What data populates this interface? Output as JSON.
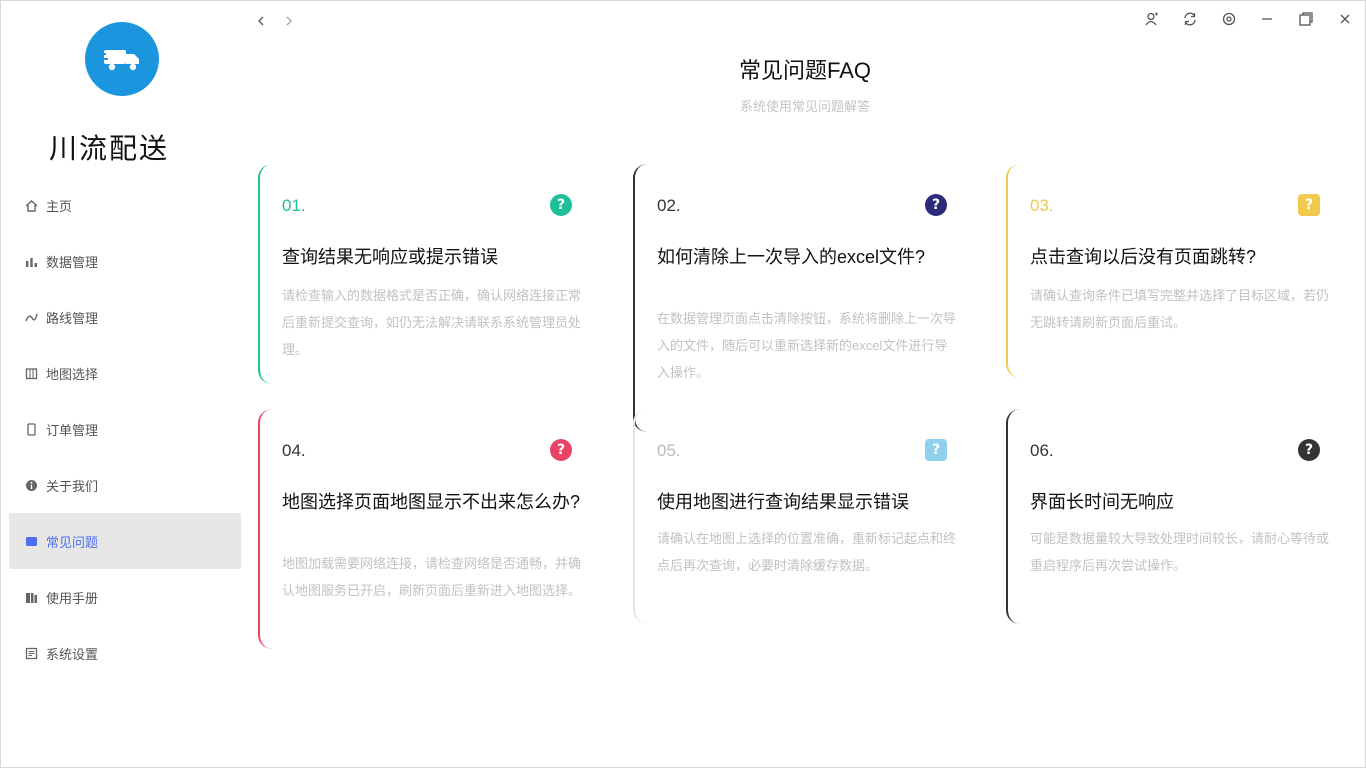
{
  "app": {
    "brand": "川流配送"
  },
  "window_controls": [
    "user-icon",
    "refresh-icon",
    "settings-icon",
    "minimize-icon",
    "maximize-icon",
    "close-icon"
  ],
  "sidebar": {
    "items": [
      {
        "label": "主页",
        "icon": "home-icon",
        "active": false
      },
      {
        "label": "数据管理",
        "icon": "chart-icon",
        "active": false
      },
      {
        "label": "路线管理",
        "icon": "route-icon",
        "active": false
      },
      {
        "label": "地图选择",
        "icon": "map-icon",
        "active": false
      },
      {
        "label": "订单管理",
        "icon": "order-icon",
        "active": false
      },
      {
        "label": "关于我们",
        "icon": "info-icon",
        "active": false
      },
      {
        "label": "常见问题",
        "icon": "faq-icon",
        "active": true
      },
      {
        "label": "使用手册",
        "icon": "book-icon",
        "active": false
      },
      {
        "label": "系统设置",
        "icon": "settings-icon",
        "active": false
      }
    ]
  },
  "header": {
    "title": "常见问题FAQ",
    "subtitle": "系统使用常见问题解答"
  },
  "colors": {
    "accent": "#4f6ef0",
    "logo": "#1b96de"
  },
  "faq": [
    {
      "num": "01.",
      "title": "查询结果无响应或提示错误",
      "answer": "请检查输入的数据格式是否正确，确认网络连接正常后重新提交查询，如仍无法解决请联系系统管理员处理。",
      "color": "#1fbf9a"
    },
    {
      "num": "02.",
      "title": "如何清除上一次导入的excel文件?",
      "answer": "在数据管理页面点击清除按钮，系统将删除上一次导入的文件，随后可以重新选择新的excel文件进行导入操作。",
      "color": "#2d2a7a"
    },
    {
      "num": "03.",
      "title": "点击查询以后没有页面跳转?",
      "answer": "请确认查询条件已填写完整并选择了目标区域，若仍无跳转请刷新页面后重试。",
      "color": "#f2c94c"
    },
    {
      "num": "04.",
      "title": "地图选择页面地图显示不出来怎么办?",
      "answer": "地图加载需要网络连接，请检查网络是否通畅，并确认地图服务已开启，刷新页面后重新进入地图选择。",
      "color": "#e94467"
    },
    {
      "num": "05.",
      "title": "使用地图进行查询结果显示错误",
      "answer": "请确认在地图上选择的位置准确，重新标记起点和终点后再次查询，必要时清除缓存数据。",
      "color": "#8fd0ee"
    },
    {
      "num": "06.",
      "title": "界面长时间无响应",
      "answer": "可能是数据量较大导致处理时间较长，请耐心等待或重启程序后再次尝试操作。",
      "color": "#333333"
    }
  ]
}
